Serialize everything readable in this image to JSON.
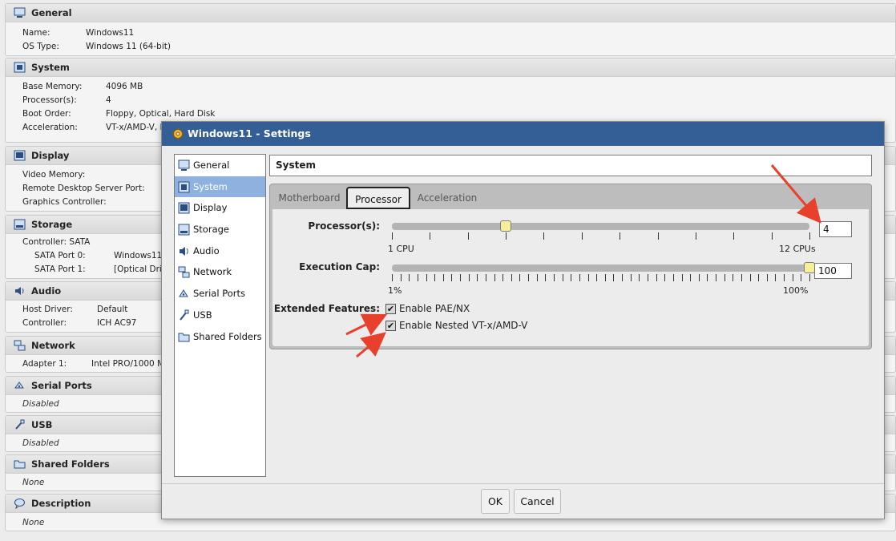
{
  "details": {
    "general": {
      "title": "General",
      "rows": [
        {
          "k": "Name:",
          "v": "Windows11"
        },
        {
          "k": "OS Type:",
          "v": "Windows 11 (64-bit)"
        }
      ]
    },
    "system": {
      "title": "System",
      "rows": [
        {
          "k": "Base Memory:",
          "v": "4096 MB"
        },
        {
          "k": "Processor(s):",
          "v": "4"
        },
        {
          "k": "Boot Order:",
          "v": "Floppy, Optical, Hard Disk"
        },
        {
          "k": "Acceleration:",
          "v": "VT-x/AMD-V, N"
        }
      ]
    },
    "display": {
      "title": "Display",
      "rows": [
        {
          "k": "Video Memory:"
        },
        {
          "k": "Remote Desktop Server Port:"
        },
        {
          "k": "Graphics Controller:"
        }
      ]
    },
    "storage": {
      "title": "Storage",
      "controller": "Controller: SATA",
      "ports": [
        {
          "k": "SATA Port 0:",
          "v": "Windows11."
        },
        {
          "k": "SATA Port 1:",
          "v": "[Optical Driv"
        }
      ]
    },
    "audio": {
      "title": "Audio",
      "rows": [
        {
          "k": "Host Driver:",
          "v": "Default"
        },
        {
          "k": "Controller:",
          "v": "ICH AC97"
        }
      ]
    },
    "network": {
      "title": "Network",
      "rows": [
        {
          "k": "Adapter 1:",
          "v": "Intel PRO/1000 M"
        }
      ]
    },
    "serial": {
      "title": "Serial Ports",
      "value": "Disabled"
    },
    "usb": {
      "title": "USB",
      "value": "Disabled"
    },
    "shared": {
      "title": "Shared Folders",
      "value": "None"
    },
    "description": {
      "title": "Description",
      "value": "None"
    }
  },
  "dialog": {
    "title": "Windows11 - Settings",
    "nav": [
      "General",
      "System",
      "Display",
      "Storage",
      "Audio",
      "Network",
      "Serial Ports",
      "USB",
      "Shared Folders"
    ],
    "selected_nav": "System",
    "page_title": "System",
    "tabs": [
      "Motherboard",
      "Processor",
      "Acceleration"
    ],
    "active_tab": "Processor",
    "processor": {
      "label": "Processor(s):",
      "value": 4,
      "min": 1,
      "max": 12,
      "min_label": "1 CPU",
      "max_label": "12 CPUs",
      "field": "4"
    },
    "exec_cap": {
      "label": "Execution Cap:",
      "value": 100,
      "min": 1,
      "max": 100,
      "min_label": "1%",
      "max_label": "100%",
      "field": "100"
    },
    "extended": {
      "label": "Extended Features:",
      "options": [
        {
          "label": "Enable PAE/NX",
          "checked": true
        },
        {
          "label": "Enable Nested VT-x/AMD-V",
          "checked": true
        }
      ]
    },
    "buttons": {
      "ok": "OK",
      "cancel": "Cancel"
    }
  },
  "colors": {
    "title_bar": "#335f96",
    "selected_nav": "#8fb1e0",
    "handle": "#f7ee9a",
    "annotation_arrow": "#e8402a"
  }
}
